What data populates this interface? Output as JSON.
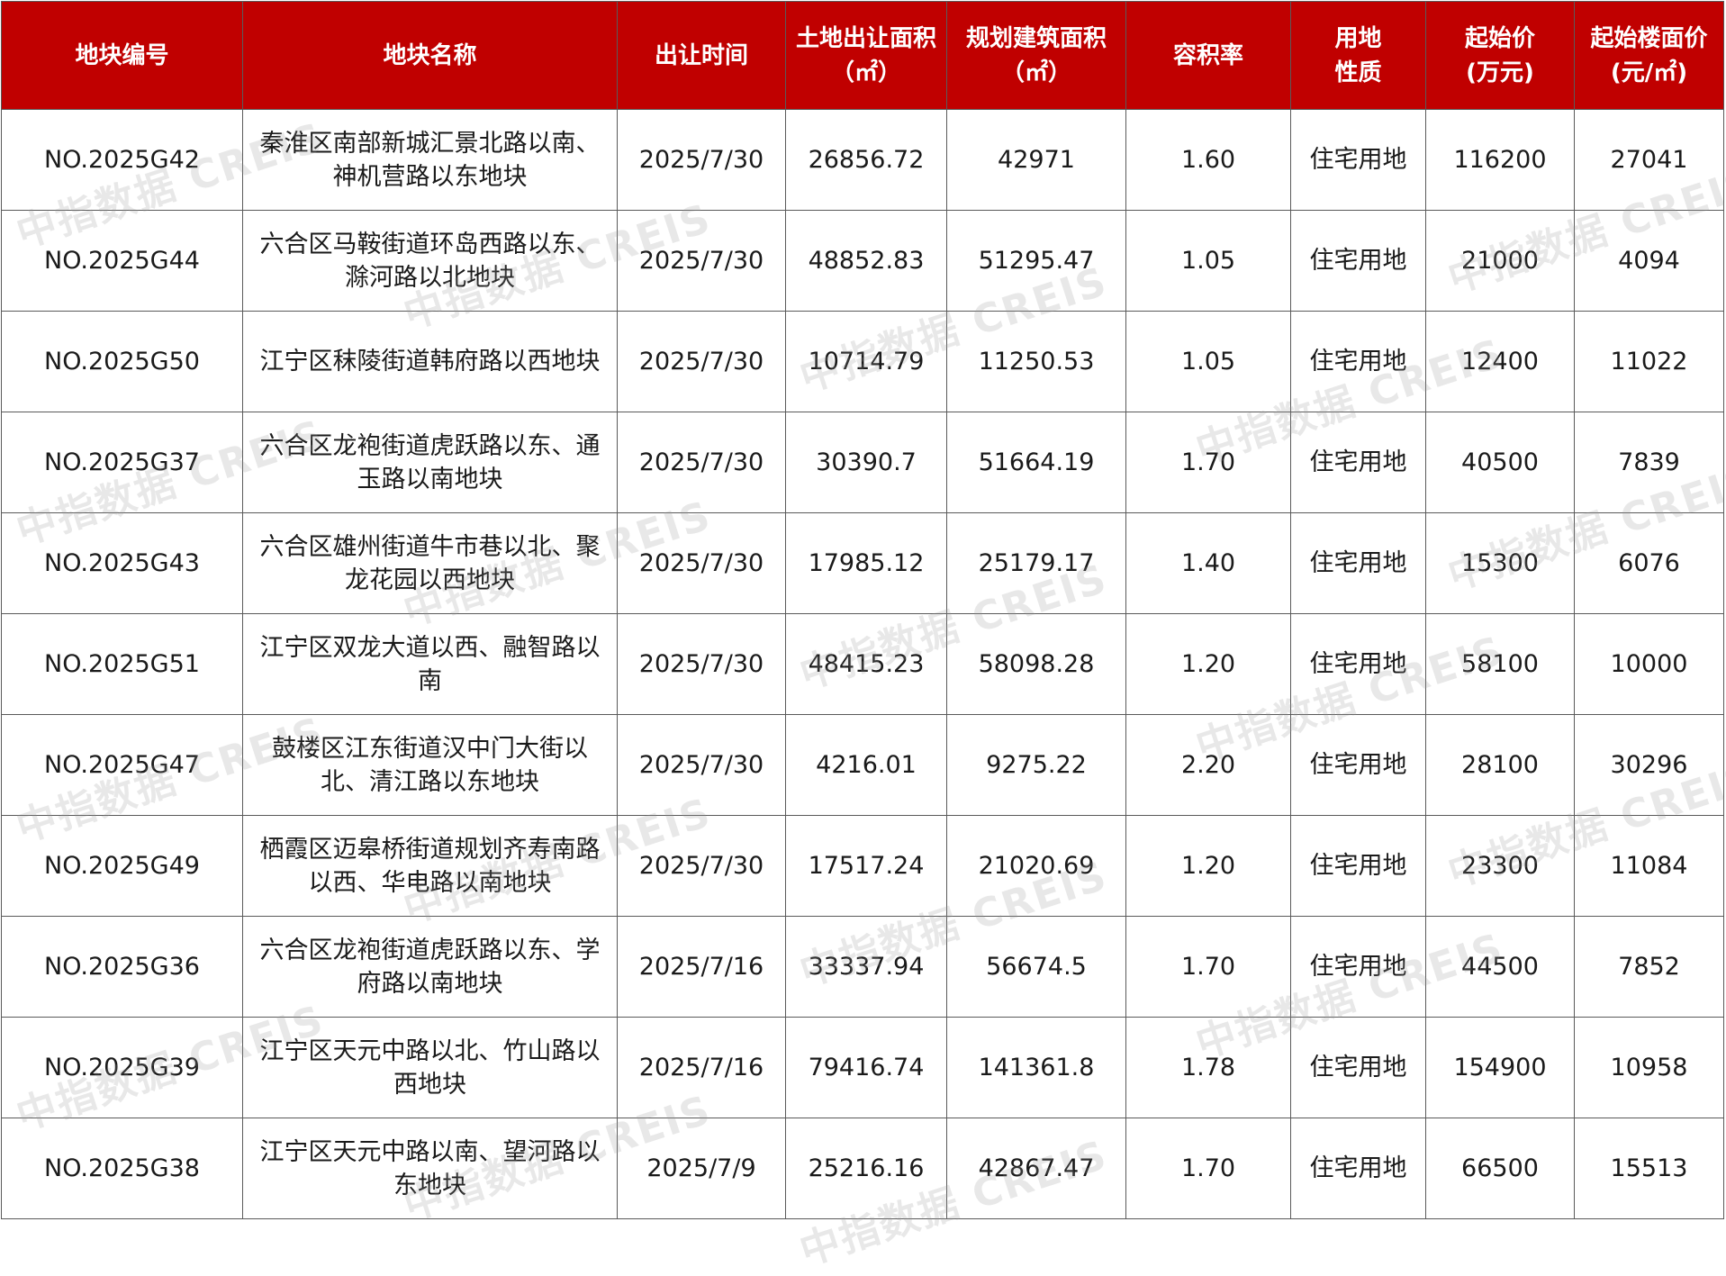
{
  "table": {
    "header_color": "#c00000",
    "headers": [
      [
        "地块编号"
      ],
      [
        "地块名称"
      ],
      [
        "出让时间"
      ],
      [
        "土地出让面积",
        "（㎡）"
      ],
      [
        "规划建筑面积",
        "（㎡）"
      ],
      [
        "容积率"
      ],
      [
        "用地",
        "性质"
      ],
      [
        "起始价",
        "(万元)"
      ],
      [
        "起始楼面价",
        "(元/㎡)"
      ]
    ],
    "rows": [
      [
        "NO.2025G42",
        "秦淮区南部新城汇景北路以南、神机营路以东地块",
        "2025/7/30",
        "26856.72",
        "42971",
        "1.60",
        "住宅用地",
        "116200",
        "27041"
      ],
      [
        "NO.2025G44",
        "六合区马鞍街道环岛西路以东、滁河路以北地块",
        "2025/7/30",
        "48852.83",
        "51295.47",
        "1.05",
        "住宅用地",
        "21000",
        "4094"
      ],
      [
        "NO.2025G50",
        "江宁区秣陵街道韩府路以西地块",
        "2025/7/30",
        "10714.79",
        "11250.53",
        "1.05",
        "住宅用地",
        "12400",
        "11022"
      ],
      [
        "NO.2025G37",
        "六合区龙袍街道虎跃路以东、通玉路以南地块",
        "2025/7/30",
        "30390.7",
        "51664.19",
        "1.70",
        "住宅用地",
        "40500",
        "7839"
      ],
      [
        "NO.2025G43",
        "六合区雄州街道牛市巷以北、聚龙花园以西地块",
        "2025/7/30",
        "17985.12",
        "25179.17",
        "1.40",
        "住宅用地",
        "15300",
        "6076"
      ],
      [
        "NO.2025G51",
        "江宁区双龙大道以西、融智路以南",
        "2025/7/30",
        "48415.23",
        "58098.28",
        "1.20",
        "住宅用地",
        "58100",
        "10000"
      ],
      [
        "NO.2025G47",
        "鼓楼区江东街道汉中门大街以北、清江路以东地块",
        "2025/7/30",
        "4216.01",
        "9275.22",
        "2.20",
        "住宅用地",
        "28100",
        "30296"
      ],
      [
        "NO.2025G49",
        "栖霞区迈皋桥街道规划齐寿南路以西、华电路以南地块",
        "2025/7/30",
        "17517.24",
        "21020.69",
        "1.20",
        "住宅用地",
        "23300",
        "11084"
      ],
      [
        "NO.2025G36",
        "六合区龙袍街道虎跃路以东、学府路以南地块",
        "2025/7/16",
        "33337.94",
        "56674.5",
        "1.70",
        "住宅用地",
        "44500",
        "7852"
      ],
      [
        "NO.2025G39",
        "江宁区天元中路以北、竹山路以西地块",
        "2025/7/16",
        "79416.74",
        "141361.8",
        "1.78",
        "住宅用地",
        "154900",
        "10958"
      ],
      [
        "NO.2025G38",
        "江宁区天元中路以南、望河路以东地块",
        "2025/7/9",
        "25216.16",
        "42867.47",
        "1.70",
        "住宅用地",
        "66500",
        "15513"
      ]
    ]
  },
  "watermark": "中指数据 CREIS"
}
